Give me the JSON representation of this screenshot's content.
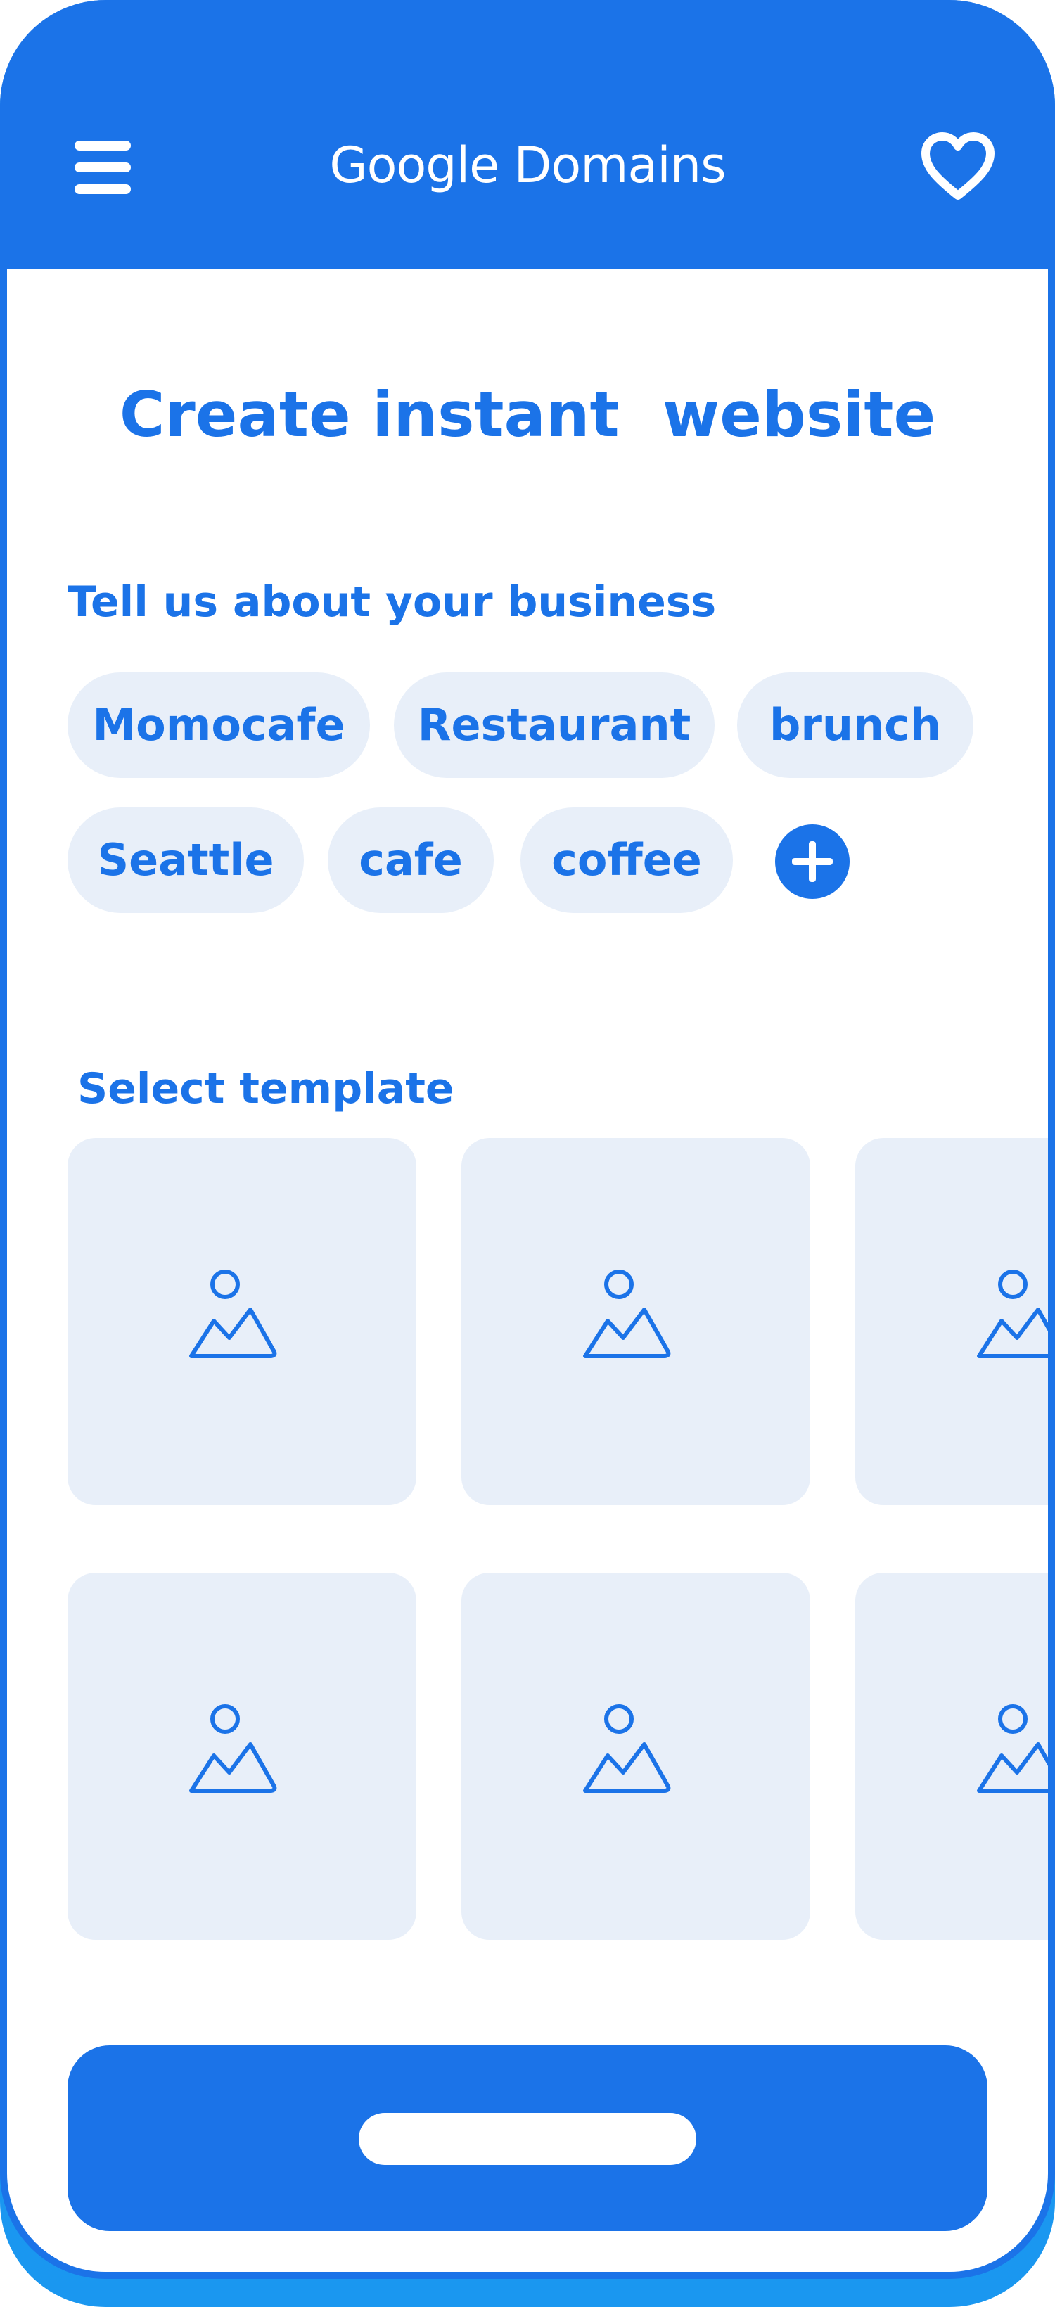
{
  "colors": {
    "brand_blue": "#1b73e8",
    "chip_background": "#e8eff9",
    "frame_shadow": "#1a97f0",
    "surface": "#ffffff"
  },
  "header": {
    "brand_title": "Google Domains",
    "menu_icon": "hamburger-menu-icon",
    "favorite_icon": "heart-icon"
  },
  "page": {
    "title": "Create instant  website"
  },
  "business": {
    "label": "Tell us about your business",
    "tags": [
      "Momocafe",
      "Restaurant",
      "brunch",
      "Seattle",
      "cafe",
      "coffee"
    ],
    "add_icon": "plus-circle-icon"
  },
  "templates": {
    "label": "Select template",
    "placeholder_icon": "image-placeholder-icon"
  },
  "footer": {
    "cta_icon": "pill-placeholder"
  }
}
